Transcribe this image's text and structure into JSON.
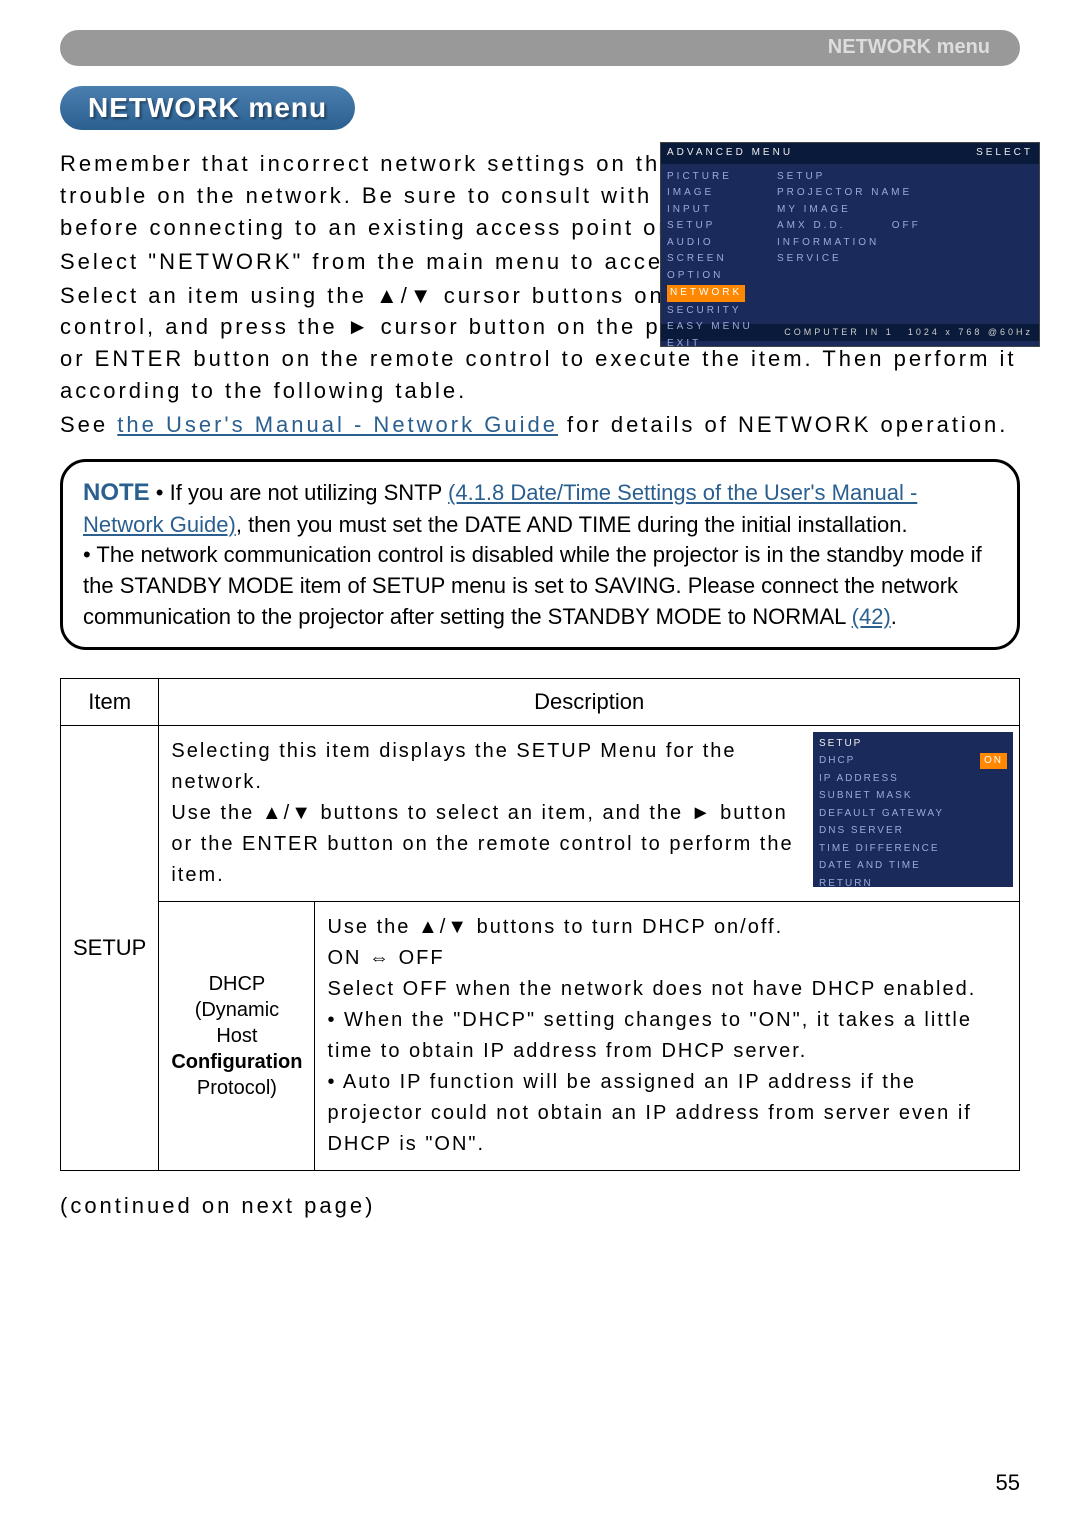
{
  "header": {
    "label": "NETWORK menu"
  },
  "title": "NETWORK menu",
  "intro": {
    "p1": "Remember that incorrect network settings on this projector may cause trouble on the network. Be sure to consult with your network administrator before connecting to an existing access point on your network.",
    "p2": "Select \"NETWORK\" from the main menu to access the following functions.",
    "p3": "Select an item using the ▲/▼ cursor buttons on the projector or remote control, and press the ► cursor button on the projector or remote control, or ENTER button on the remote control to execute the item. Then perform it according to the following table.",
    "p4_pre": "See ",
    "p4_link": "the User's Manual - Network Guide",
    "p4_post": " for details of NETWORK operation."
  },
  "osd_adv": {
    "topL": "ADVANCED MENU",
    "topR": "SELECT",
    "left": [
      "PICTURE",
      "IMAGE",
      "INPUT",
      "SETUP",
      "AUDIO",
      "SCREEN",
      "OPTION",
      "NETWORK",
      "SECURITY",
      "EASY MENU",
      "EXIT"
    ],
    "right": [
      "SETUP",
      "PROJECTOR NAME",
      "MY IMAGE",
      "AMX D.D.",
      "INFORMATION",
      "SERVICE"
    ],
    "off": "OFF",
    "footL": "COMPUTER IN 1",
    "footR": "1024 x 768 @60Hz"
  },
  "note": {
    "label": "NOTE",
    "l1_pre": " • If you are not utilizing SNTP ",
    "l1_link": "(4.1.8 Date/Time Settings of the User's Manual - Network Guide)",
    "l1_post": ", then you must set the DATE AND TIME during the initial installation.",
    "l2_pre": "• The network communication control is disabled while the projector is in the standby mode if the STANDBY MODE item of SETUP menu is set to SAVING. Please connect the network communication to the projector after setting the STANDBY MODE to NORMAL ",
    "l2_link": "(42)",
    "l2_post": "."
  },
  "table": {
    "h1": "Item",
    "h2": "Description",
    "setup_label": "SETUP",
    "setup_text": "Selecting this item displays the SETUP Menu for the network.\nUse the ▲/▼ buttons to select an item, and the ► button or the ENTER button on the remote control to perform the item.",
    "dhcp_label": "DHCP\n(Dynamic Host\nConfiguration\nProtocol)",
    "dhcp_text": "Use the ▲/▼ buttons to turn DHCP on/off.\nON ⇔ OFF\nSelect OFF when the network does not have DHCP enabled.\n• When the \"DHCP\" setting changes to \"ON\", it takes a little time to obtain IP address from DHCP server.\n• Auto IP function will be assigned an IP address if the projector could not obtain an IP address from server even if DHCP is \"ON\"."
  },
  "osd_setup": {
    "title": "SETUP",
    "on": "ON",
    "items": [
      "DHCP",
      "IP ADDRESS",
      "SUBNET MASK",
      "DEFAULT GATEWAY",
      "DNS SERVER",
      "TIME DIFFERENCE",
      "DATE AND TIME",
      "RETURN"
    ]
  },
  "footer": "(continued on next page)",
  "pageno": "55"
}
